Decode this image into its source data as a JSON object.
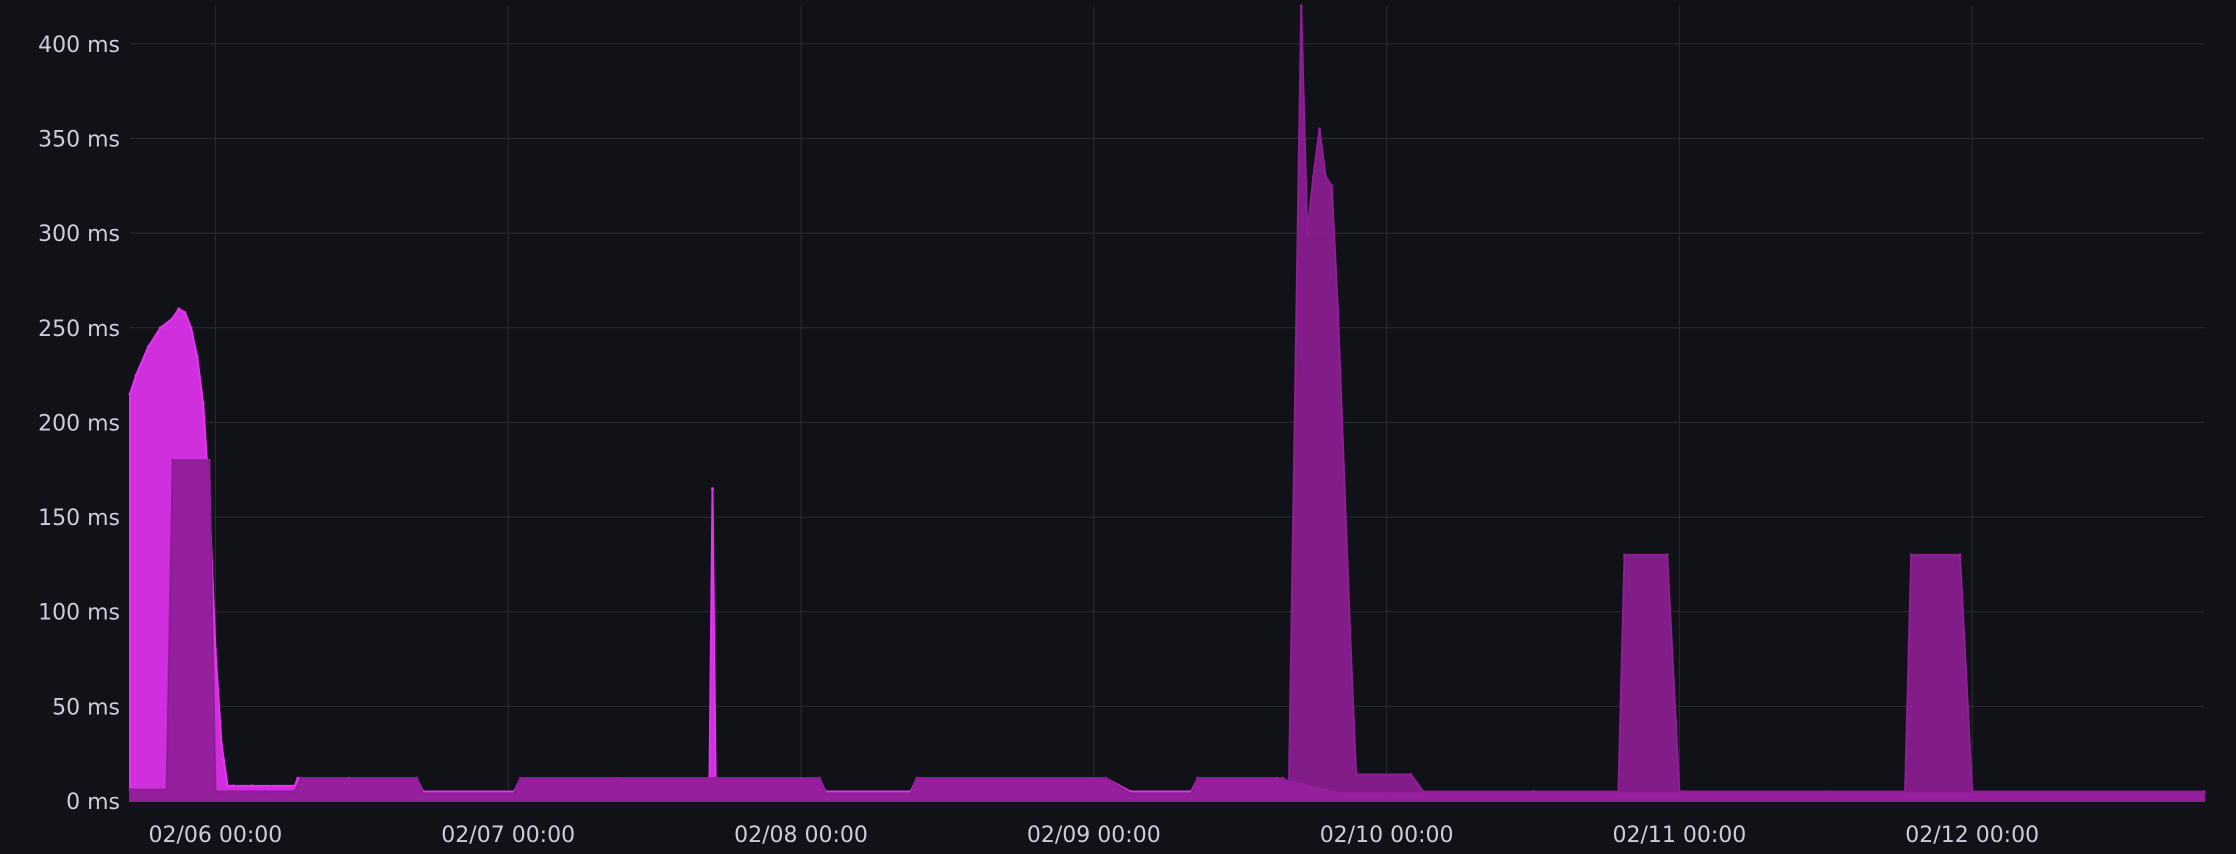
{
  "chart_data": {
    "type": "area",
    "title": "",
    "xlabel": "",
    "ylabel": "",
    "y_unit": "ms",
    "ylim": [
      0,
      420
    ],
    "xlim": [
      "2025-02-05 17:00",
      "2025-02-12 19:00"
    ],
    "grid": true,
    "legend": "none",
    "y_ticks": [
      {
        "value": 0,
        "label": "0 ms"
      },
      {
        "value": 50,
        "label": "50 ms"
      },
      {
        "value": 100,
        "label": "100 ms"
      },
      {
        "value": 150,
        "label": "150 ms"
      },
      {
        "value": 200,
        "label": "200 ms"
      },
      {
        "value": 250,
        "label": "250 ms"
      },
      {
        "value": 300,
        "label": "300 ms"
      },
      {
        "value": 350,
        "label": "350 ms"
      },
      {
        "value": 400,
        "label": "400 ms"
      }
    ],
    "x_ticks": [
      {
        "value": "2025-02-06 00:00",
        "label": "02/06 00:00"
      },
      {
        "value": "2025-02-07 00:00",
        "label": "02/07 00:00"
      },
      {
        "value": "2025-02-08 00:00",
        "label": "02/08 00:00"
      },
      {
        "value": "2025-02-09 00:00",
        "label": "02/09 00:00"
      },
      {
        "value": "2025-02-10 00:00",
        "label": "02/10 00:00"
      },
      {
        "value": "2025-02-11 00:00",
        "label": "02/11 00:00"
      },
      {
        "value": "2025-02-12 00:00",
        "label": "02/12 00:00"
      }
    ],
    "series": [
      {
        "color": "#e433f2",
        "x": [
          "2025-02-05 17:00",
          "2025-02-05 17:30",
          "2025-02-05 18:30",
          "2025-02-05 19:30",
          "2025-02-05 20:30",
          "2025-02-05 21:00",
          "2025-02-05 21:30",
          "2025-02-05 22:00",
          "2025-02-05 22:30",
          "2025-02-05 23:00",
          "2025-02-05 23:30",
          "2025-02-06 00:00",
          "2025-02-06 00:30",
          "2025-02-06 01:00",
          "2025-02-06 01:30",
          "2025-02-06 03:00",
          "2025-02-06 06:30",
          "2025-02-06 06:45",
          "2025-02-06 11:00",
          "2025-02-06 16:30",
          "2025-02-06 17:00",
          "2025-02-07 00:30",
          "2025-02-07 01:00",
          "2025-02-07 09:00",
          "2025-02-07 16:30",
          "2025-02-07 16:45",
          "2025-02-07 17:00",
          "2025-02-08 01:30",
          "2025-02-08 02:00",
          "2025-02-08 09:00",
          "2025-02-08 09:30",
          "2025-02-09 01:00",
          "2025-02-09 03:00",
          "2025-02-09 08:00",
          "2025-02-09 08:30",
          "2025-02-09 15:00",
          "2025-02-09 20:00",
          "2025-02-10 00:00",
          "2025-02-10 12:00",
          "2025-02-11 00:00",
          "2025-02-11 12:00",
          "2025-02-12 00:00",
          "2025-02-12 19:00"
        ],
        "values": [
          215,
          225,
          240,
          250,
          255,
          260,
          258,
          250,
          235,
          210,
          160,
          80,
          30,
          8,
          8,
          8,
          8,
          12,
          12,
          12,
          5,
          5,
          12,
          12,
          12,
          165,
          12,
          12,
          5,
          5,
          12,
          12,
          5,
          5,
          12,
          12,
          4,
          4,
          4,
          4,
          4,
          4,
          4
        ]
      },
      {
        "color": "#8e1e96",
        "x": [
          "2025-02-05 17:00",
          "2025-02-05 20:00",
          "2025-02-05 20:30",
          "2025-02-05 23:30",
          "2025-02-06 00:00",
          "2025-02-06 04:00",
          "2025-02-06 06:30",
          "2025-02-06 07:00",
          "2025-02-06 16:30",
          "2025-02-06 17:00",
          "2025-02-07 00:30",
          "2025-02-07 01:00",
          "2025-02-07 09:00",
          "2025-02-07 17:00",
          "2025-02-08 01:30",
          "2025-02-08 02:00",
          "2025-02-08 09:00",
          "2025-02-08 09:30",
          "2025-02-09 01:00",
          "2025-02-09 03:00",
          "2025-02-09 08:00",
          "2025-02-09 08:30",
          "2025-02-09 15:30",
          "2025-02-09 16:00",
          "2025-02-09 17:00",
          "2025-02-09 17:30",
          "2025-02-09 18:00",
          "2025-02-09 18:30",
          "2025-02-09 19:00",
          "2025-02-09 19:30",
          "2025-02-09 20:00",
          "2025-02-09 21:00",
          "2025-02-09 21:30",
          "2025-02-10 02:00",
          "2025-02-10 03:00",
          "2025-02-10 12:00",
          "2025-02-10 19:00",
          "2025-02-10 19:30",
          "2025-02-10 23:00",
          "2025-02-11 00:00",
          "2025-02-11 12:00",
          "2025-02-11 18:30",
          "2025-02-11 19:00",
          "2025-02-11 23:00",
          "2025-02-12 00:00",
          "2025-02-12 19:00"
        ],
        "values": [
          6,
          6,
          180,
          180,
          5,
          5,
          5,
          12,
          12,
          4,
          4,
          12,
          12,
          12,
          12,
          4,
          4,
          12,
          12,
          4,
          4,
          12,
          12,
          10,
          420,
          300,
          330,
          355,
          330,
          325,
          260,
          90,
          14,
          14,
          5,
          5,
          5,
          130,
          130,
          5,
          5,
          5,
          130,
          130,
          5,
          5
        ]
      }
    ]
  }
}
